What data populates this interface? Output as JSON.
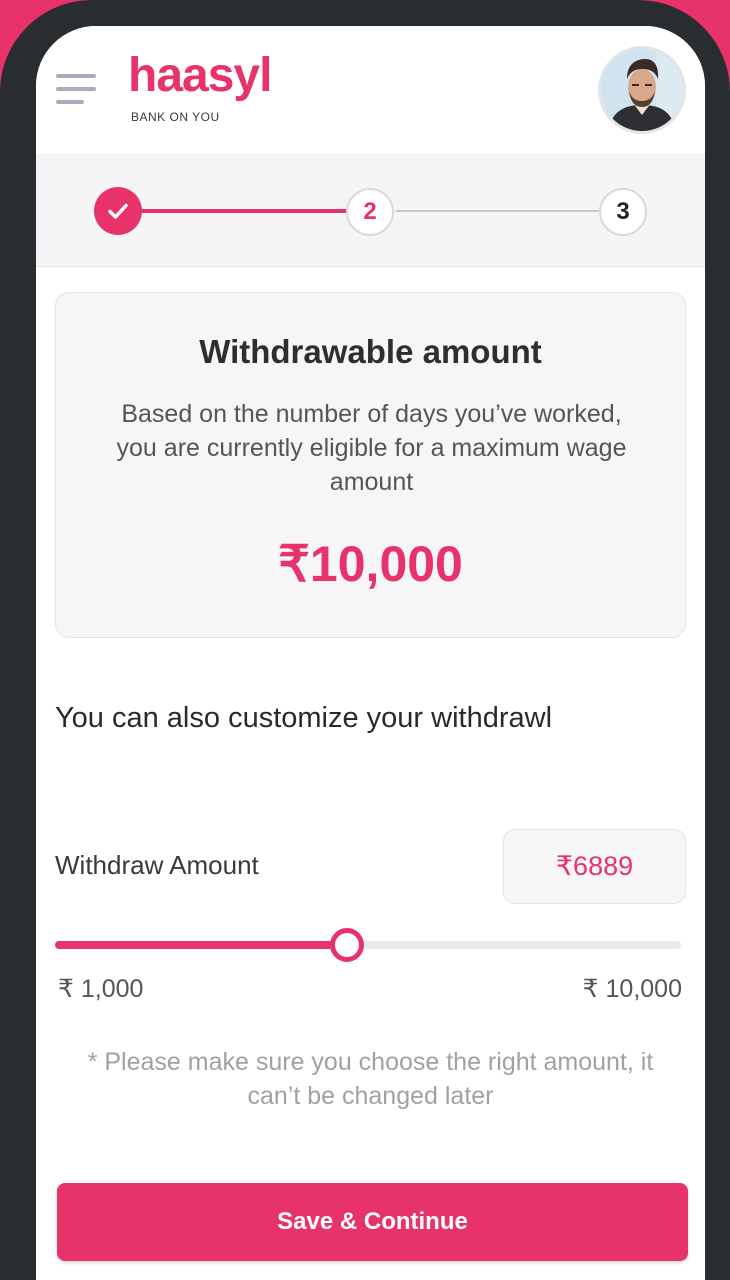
{
  "brand": {
    "name": "haasyl",
    "tagline": "BANK ON YOU",
    "accent": "#e8336a"
  },
  "header": {
    "menu_icon": "hamburger-menu-icon",
    "avatar_icon": "user-avatar"
  },
  "stepper": {
    "steps": [
      {
        "label": "",
        "state": "done",
        "icon": "check-icon"
      },
      {
        "label": "2",
        "state": "active"
      },
      {
        "label": "3",
        "state": "upcoming"
      }
    ]
  },
  "card": {
    "title": "Withdrawable amount",
    "description": "Based on the number of days you’ve worked, you are currently eligible for a maximum wage amount",
    "amount": "₹10,000"
  },
  "customize": {
    "heading": "You can also customize your withdrawl"
  },
  "withdraw": {
    "label": "Withdraw Amount",
    "value": "₹6889",
    "slider": {
      "min_label": "₹ 1,000",
      "max_label": "₹ 10,000",
      "min": 1000,
      "max": 10000,
      "current": 5200
    }
  },
  "note": "* Please make sure you choose the right amount, it can’t be changed later",
  "cta": {
    "label": "Save & Continue"
  }
}
